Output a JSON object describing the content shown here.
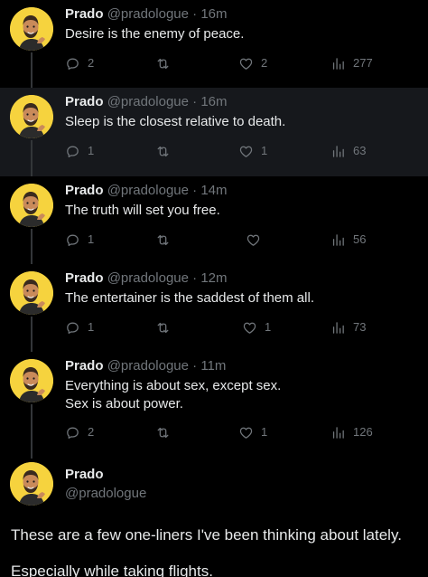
{
  "colors": {
    "background": "#000000",
    "highlight": "#16181c",
    "text_primary": "#e7e9ea",
    "text_secondary": "#71767b",
    "thread_line": "#333639",
    "avatar_bg": "#f6d33e"
  },
  "icons": {
    "reply": "speech-bubble-icon",
    "retweet": "retweet-arrows-icon",
    "like": "heart-icon",
    "views": "bar-chart-icon"
  },
  "thread": [
    {
      "name": "Prado",
      "handle": "@pradologue",
      "separator": "·",
      "time": "16m",
      "lines": [
        "Desire is the enemy of peace."
      ],
      "replies": "2",
      "retweets": "",
      "likes": "2",
      "views": "277"
    },
    {
      "name": "Prado",
      "handle": "@pradologue",
      "separator": "·",
      "time": "16m",
      "lines": [
        "Sleep is the closest relative to death."
      ],
      "replies": "1",
      "retweets": "",
      "likes": "1",
      "views": "63"
    },
    {
      "name": "Prado",
      "handle": "@pradologue",
      "separator": "·",
      "time": "14m",
      "lines": [
        "The truth will set you free."
      ],
      "replies": "1",
      "retweets": "",
      "likes": "",
      "views": "56"
    },
    {
      "name": "Prado",
      "handle": "@pradologue",
      "separator": "·",
      "time": "12m",
      "lines": [
        "The entertainer is the saddest of them all."
      ],
      "replies": "1",
      "retweets": "",
      "likes": "1",
      "views": "73"
    },
    {
      "name": "Prado",
      "handle": "@pradologue",
      "separator": "·",
      "time": "11m",
      "lines": [
        "Everything is about sex, except sex.",
        "Sex is about power."
      ],
      "replies": "2",
      "retweets": "",
      "likes": "1",
      "views": "126"
    }
  ],
  "main_tweet": {
    "name": "Prado",
    "handle": "@pradologue",
    "paragraphs": [
      "These are a few one-liners I've been thinking about lately.",
      "Especially while taking flights."
    ]
  }
}
